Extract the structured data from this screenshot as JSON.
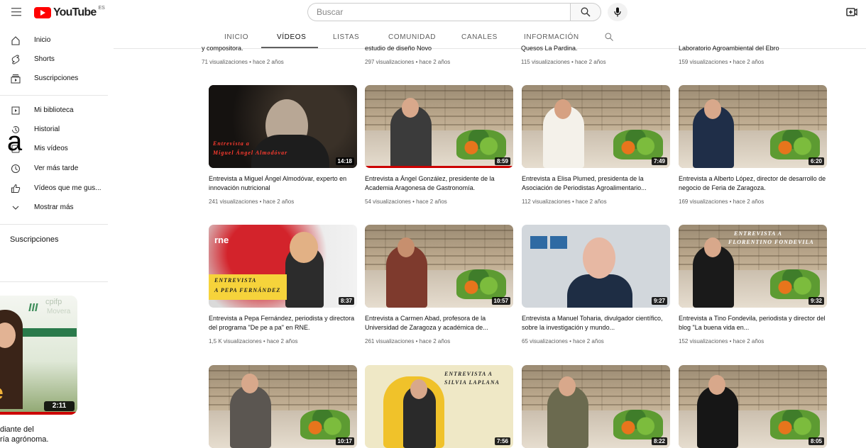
{
  "header": {
    "logo_text": "YouTube",
    "logo_country": "ES",
    "search_placeholder": "Buscar"
  },
  "tabs": [
    {
      "label": "INICIO",
      "active": false
    },
    {
      "label": "VÍDEOS",
      "active": true
    },
    {
      "label": "LISTAS",
      "active": false
    },
    {
      "label": "COMUNIDAD",
      "active": false
    },
    {
      "label": "CANALES",
      "active": false
    },
    {
      "label": "INFORMACIÓN",
      "active": false
    }
  ],
  "sidebar": {
    "items": [
      {
        "label": "Inicio",
        "icon": "home-icon"
      },
      {
        "label": "Shorts",
        "icon": "shorts-icon"
      },
      {
        "label": "Suscripciones",
        "icon": "subscriptions-icon"
      },
      {
        "label": "Mi biblioteca",
        "icon": "library-icon"
      },
      {
        "label": "Historial",
        "icon": "history-icon"
      },
      {
        "label": "Mis vídeos",
        "icon": "my-videos-icon"
      },
      {
        "label": "Ver más tarde",
        "icon": "clock-icon"
      },
      {
        "label": "Vídeos que me gus...",
        "icon": "thumbs-up-icon"
      },
      {
        "label": "Mostrar más",
        "icon": "chevron-down-icon"
      }
    ],
    "section_title": "Suscripciones"
  },
  "overlay_char": "a",
  "promo": {
    "duration": "2:11",
    "title": "diante del\nría agrónoma.",
    "brand": "cpifp",
    "brand_sub": "Movera"
  },
  "partial_row": [
    {
      "title": "y compositora.",
      "meta": "71 visualizaciones • hace 2 años"
    },
    {
      "title": "estudio de diseño Novo",
      "meta": "297 visualizaciones • hace 2 años"
    },
    {
      "title": "Quesos La Pardina.",
      "meta": "115 visualizaciones • hace 2 años"
    },
    {
      "title": "Laboratorio Agroambiental del Ebro",
      "meta": "159 visualizaciones • hace 2 años"
    }
  ],
  "videos": [
    {
      "title": "Entrevista a Miguel Ángel Almodóvar, experto en innovación nutricional",
      "meta": "241 visualizaciones • hace 2 años",
      "duration": "14:18",
      "overlay_line1": "Entrevista a",
      "overlay_line2": "Miguel Ángel Almodóvar"
    },
    {
      "title": "Entrevista a Ángel González, presidente de la Academia Aragonesa de Gastronomía.",
      "meta": "54 visualizaciones • hace 2 años",
      "duration": "8:59"
    },
    {
      "title": "Entrevista a Elisa Plumed, presidenta de la Asociación de Periodistas Agroalimentario...",
      "meta": "112 visualizaciones • hace 2 años",
      "duration": "7:49"
    },
    {
      "title": "Entrevista a Alberto López, director de desarrollo de negocio de Feria de Zaragoza.",
      "meta": "169 visualizaciones • hace 2 años",
      "duration": "6:20"
    },
    {
      "title": "Entrevista a Pepa Fernández, periodista y directora del programa \"De pe a pa\" en RNE.",
      "meta": "1,5 K visualizaciones • hace 2 años",
      "duration": "8:37",
      "overlay_line1": "ENTREVISTA",
      "overlay_line2": "A PEPA FERNÁNDEZ",
      "badge": "rne"
    },
    {
      "title": "Entrevista a Carmen Abad, profesora de la Universidad de Zaragoza y académica de...",
      "meta": "261 visualizaciones • hace 2 años",
      "duration": "10:57"
    },
    {
      "title": "Entrevista a Manuel Toharia, divulgador científico, sobre la investigación y mundo...",
      "meta": "65 visualizaciones • hace 2 años",
      "duration": "9:27"
    },
    {
      "title": "Entrevista a Tino Fondevila, periodista y director del blog \"La buena vida en...",
      "meta": "152 visualizaciones • hace 2 años",
      "duration": "9:32",
      "overlay_line1": "ENTREVISTA A",
      "overlay_line2": "FLORENTINO FONDEVILA"
    },
    {
      "duration": "10:17"
    },
    {
      "duration": "7:56",
      "overlay_line1": "ENTREVISTA A",
      "overlay_line2": "SILVIA LAPLANA"
    },
    {
      "duration": "8:22"
    },
    {
      "duration": "8:05"
    }
  ],
  "colors": {
    "brand_red": "#ff0000",
    "text_primary": "#0f0f0f",
    "text_secondary": "#606060",
    "progress_red": "#cc0000"
  }
}
